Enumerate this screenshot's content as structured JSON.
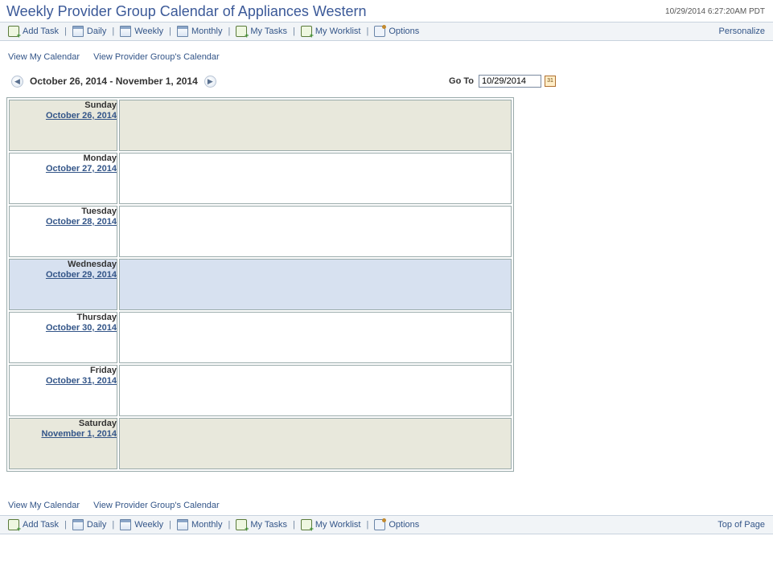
{
  "header": {
    "title": "Weekly Provider Group Calendar of Appliances Western",
    "timestamp": "10/29/2014 6:27:20AM PDT"
  },
  "toolbar": {
    "add_task": "Add Task",
    "daily": "Daily",
    "weekly": "Weekly",
    "monthly": "Monthly",
    "my_tasks": "My Tasks",
    "my_worklist": "My Worklist",
    "options": "Options",
    "personalize": "Personalize",
    "top_of_page": "Top of Page"
  },
  "view_links": {
    "my_calendar": "View My Calendar",
    "group_calendar": "View Provider Group's Calendar"
  },
  "nav": {
    "date_range": "October 26, 2014 - November 1, 2014",
    "goto_label": "Go To",
    "goto_value": "10/29/2014"
  },
  "days": [
    {
      "name": "Sunday",
      "date": "October 26, 2014",
      "cls": "weekend"
    },
    {
      "name": "Monday",
      "date": "October 27, 2014",
      "cls": ""
    },
    {
      "name": "Tuesday",
      "date": "October 28, 2014",
      "cls": ""
    },
    {
      "name": "Wednesday",
      "date": "October 29, 2014",
      "cls": "today"
    },
    {
      "name": "Thursday",
      "date": "October 30, 2014",
      "cls": ""
    },
    {
      "name": "Friday",
      "date": "October 31, 2014",
      "cls": ""
    },
    {
      "name": "Saturday",
      "date": "November 1, 2014",
      "cls": "weekend"
    }
  ]
}
